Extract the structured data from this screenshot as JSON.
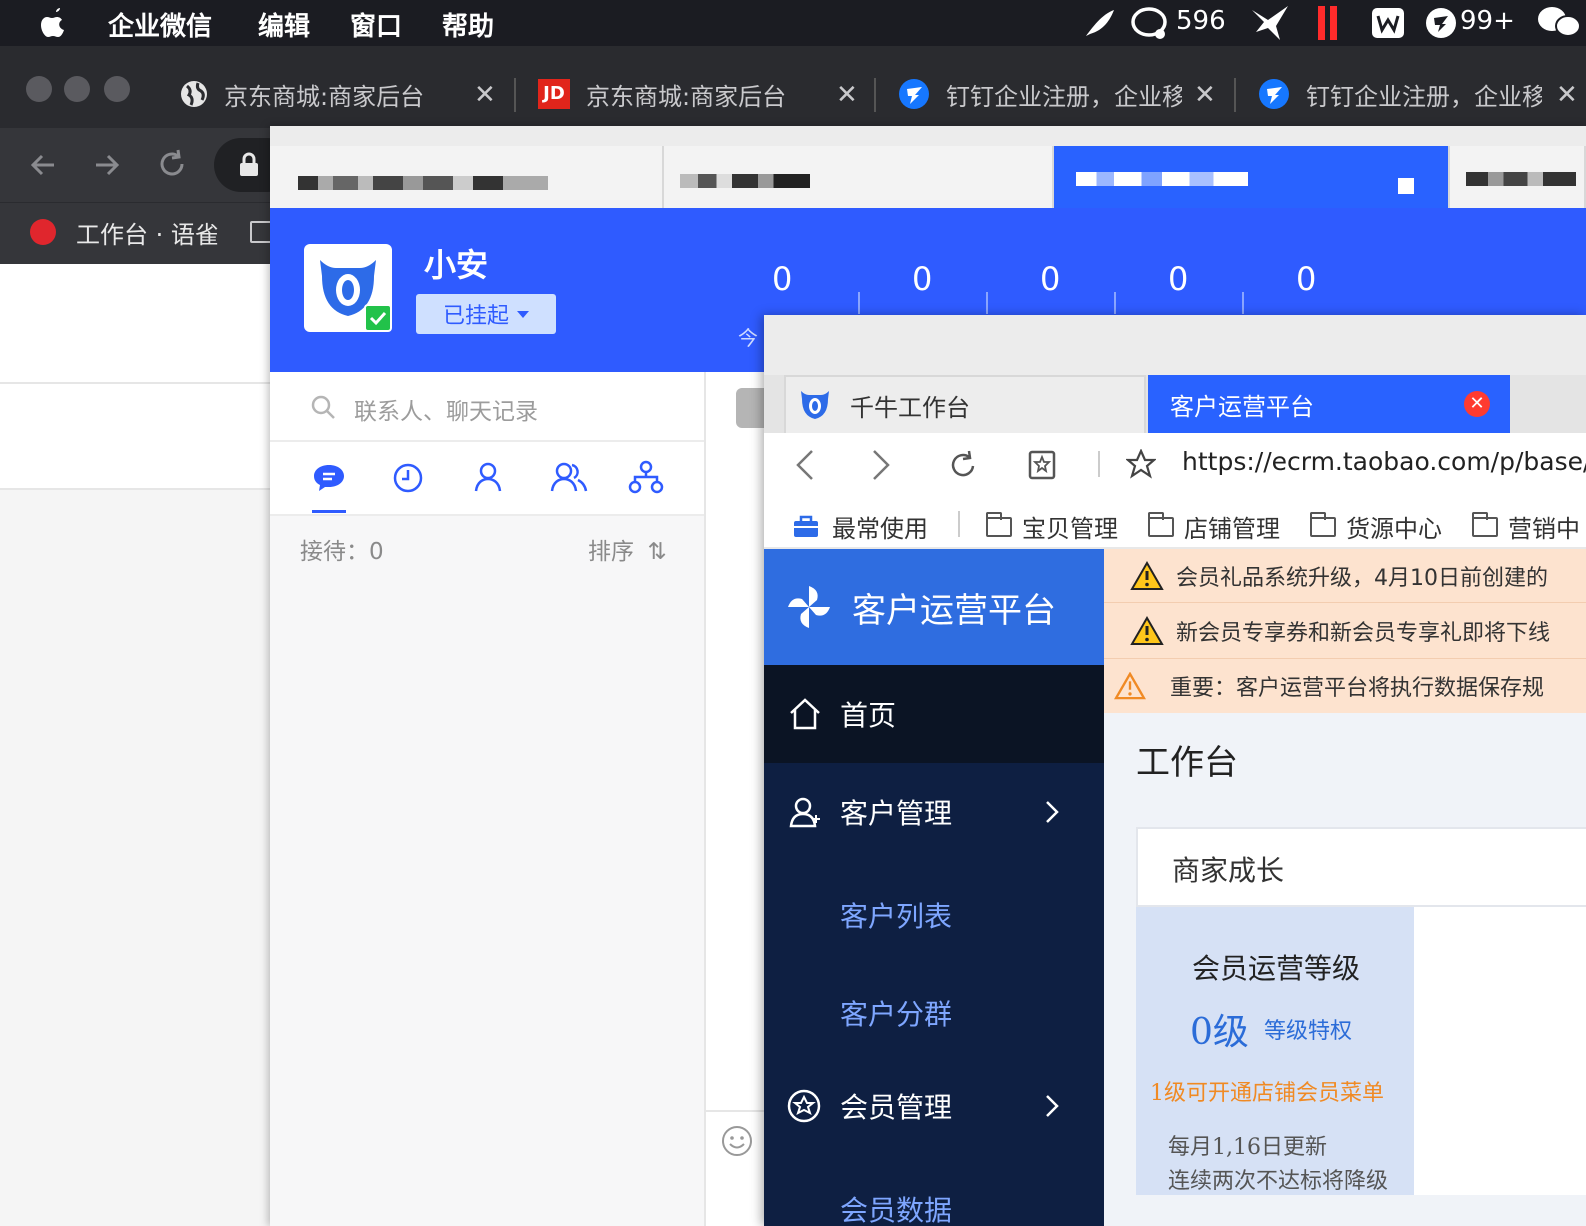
{
  "menubar": {
    "app_name": "企业微信",
    "menus": [
      "编辑",
      "窗口",
      "帮助"
    ],
    "status_count": "596",
    "status_badge": "99+"
  },
  "browser": {
    "tabs": [
      {
        "title": "京东商城:商家后台",
        "icon": "globe-icon"
      },
      {
        "title": "京东商城:商家后台",
        "icon": "jd-logo",
        "icon_text": "JD"
      },
      {
        "title": "钉钉企业注册，企业移",
        "icon": "dingtalk-icon"
      },
      {
        "title": "钉钉企业注册，企业移",
        "icon": "dingtalk-icon"
      }
    ],
    "bookmark": "工作台 · 语雀"
  },
  "qianniu": {
    "username": "小安",
    "status_label": "已挂起",
    "stats": [
      "0",
      "0",
      "0",
      "0",
      "0"
    ],
    "stat_caption_partial": "今",
    "search_placeholder": "联系人、聊天记录",
    "reception_label": "接待：",
    "reception_count": "0",
    "sort_label": "排序",
    "sort_icon_text": "⇅"
  },
  "platform": {
    "tabs": [
      {
        "label": "千牛工作台"
      },
      {
        "label": "客户运营平台"
      }
    ],
    "url": "https://ecrm.taobao.com/p/base/h",
    "bookmarks": [
      "最常使用",
      "宝贝管理",
      "店铺管理",
      "货源中心",
      "营销中"
    ],
    "brand": "客户运营平台",
    "menu": {
      "home": "首页",
      "customer": "客户管理",
      "customer_list": "客户列表",
      "customer_group": "客户分群",
      "member": "会员管理",
      "member_data": "会员数据"
    },
    "notices": [
      "会员礼品系统升级，4月10日前创建的",
      "新会员专享券和新会员专享礼即将下线",
      "重要：客户运营平台将执行数据保存规"
    ],
    "page_title": "工作台",
    "card_title": "商家成长",
    "level": {
      "title": "会员运营等级",
      "value": "0级",
      "privilege_link": "等级特权",
      "hint": "1级可开通店铺会员菜单",
      "update": "每月1,16日更新",
      "warning": "连续两次不达标将降级"
    }
  },
  "colors": {
    "qianniu_blue": "#2f5bff",
    "sidebar_navy": "#0e1f42",
    "notice_bg": "#fde3cf",
    "link_blue": "#2b6cd8",
    "hint_orange": "#f08a24"
  }
}
